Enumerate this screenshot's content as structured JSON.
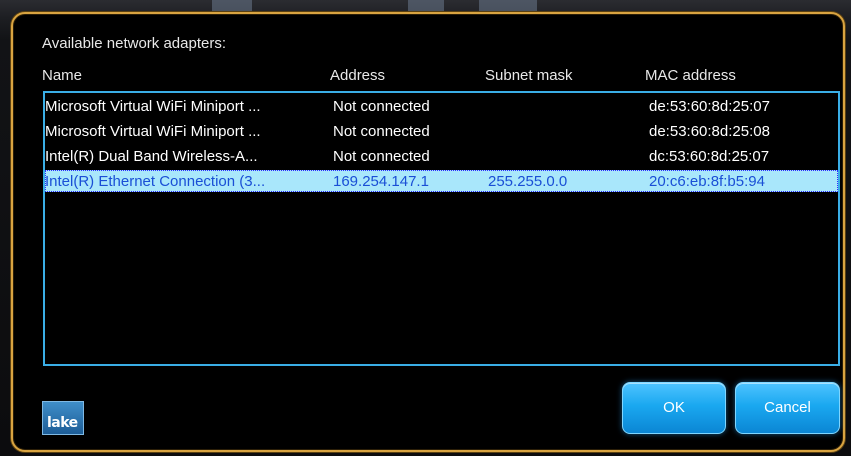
{
  "dialog": {
    "title": "Available network adapters:",
    "columns": {
      "name": "Name",
      "address": "Address",
      "subnet": "Subnet mask",
      "mac": "MAC address"
    },
    "rows": [
      {
        "name": "Microsoft Virtual WiFi Miniport ...",
        "address": "Not connected",
        "subnet": "",
        "mac": "de:53:60:8d:25:07",
        "selected": false
      },
      {
        "name": "Microsoft Virtual WiFi Miniport ...",
        "address": "Not connected",
        "subnet": "",
        "mac": "de:53:60:8d:25:08",
        "selected": false
      },
      {
        "name": "Intel(R) Dual Band Wireless-A...",
        "address": "Not connected",
        "subnet": "",
        "mac": "dc:53:60:8d:25:07",
        "selected": false
      },
      {
        "name": "Intel(R) Ethernet Connection (3...",
        "address": "169.254.147.1",
        "subnet": "255.255.0.0",
        "mac": "20:c6:eb:8f:b5:94",
        "selected": true
      }
    ],
    "logo_text": "lake",
    "ok_label": "OK",
    "cancel_label": "Cancel"
  },
  "colors": {
    "dialog_border": "#d9a441",
    "list_border": "#3aaee6",
    "selected_row_bg": "#a9e7fb",
    "selected_row_text": "#1a4fd6",
    "button": "#1aa8f0"
  }
}
